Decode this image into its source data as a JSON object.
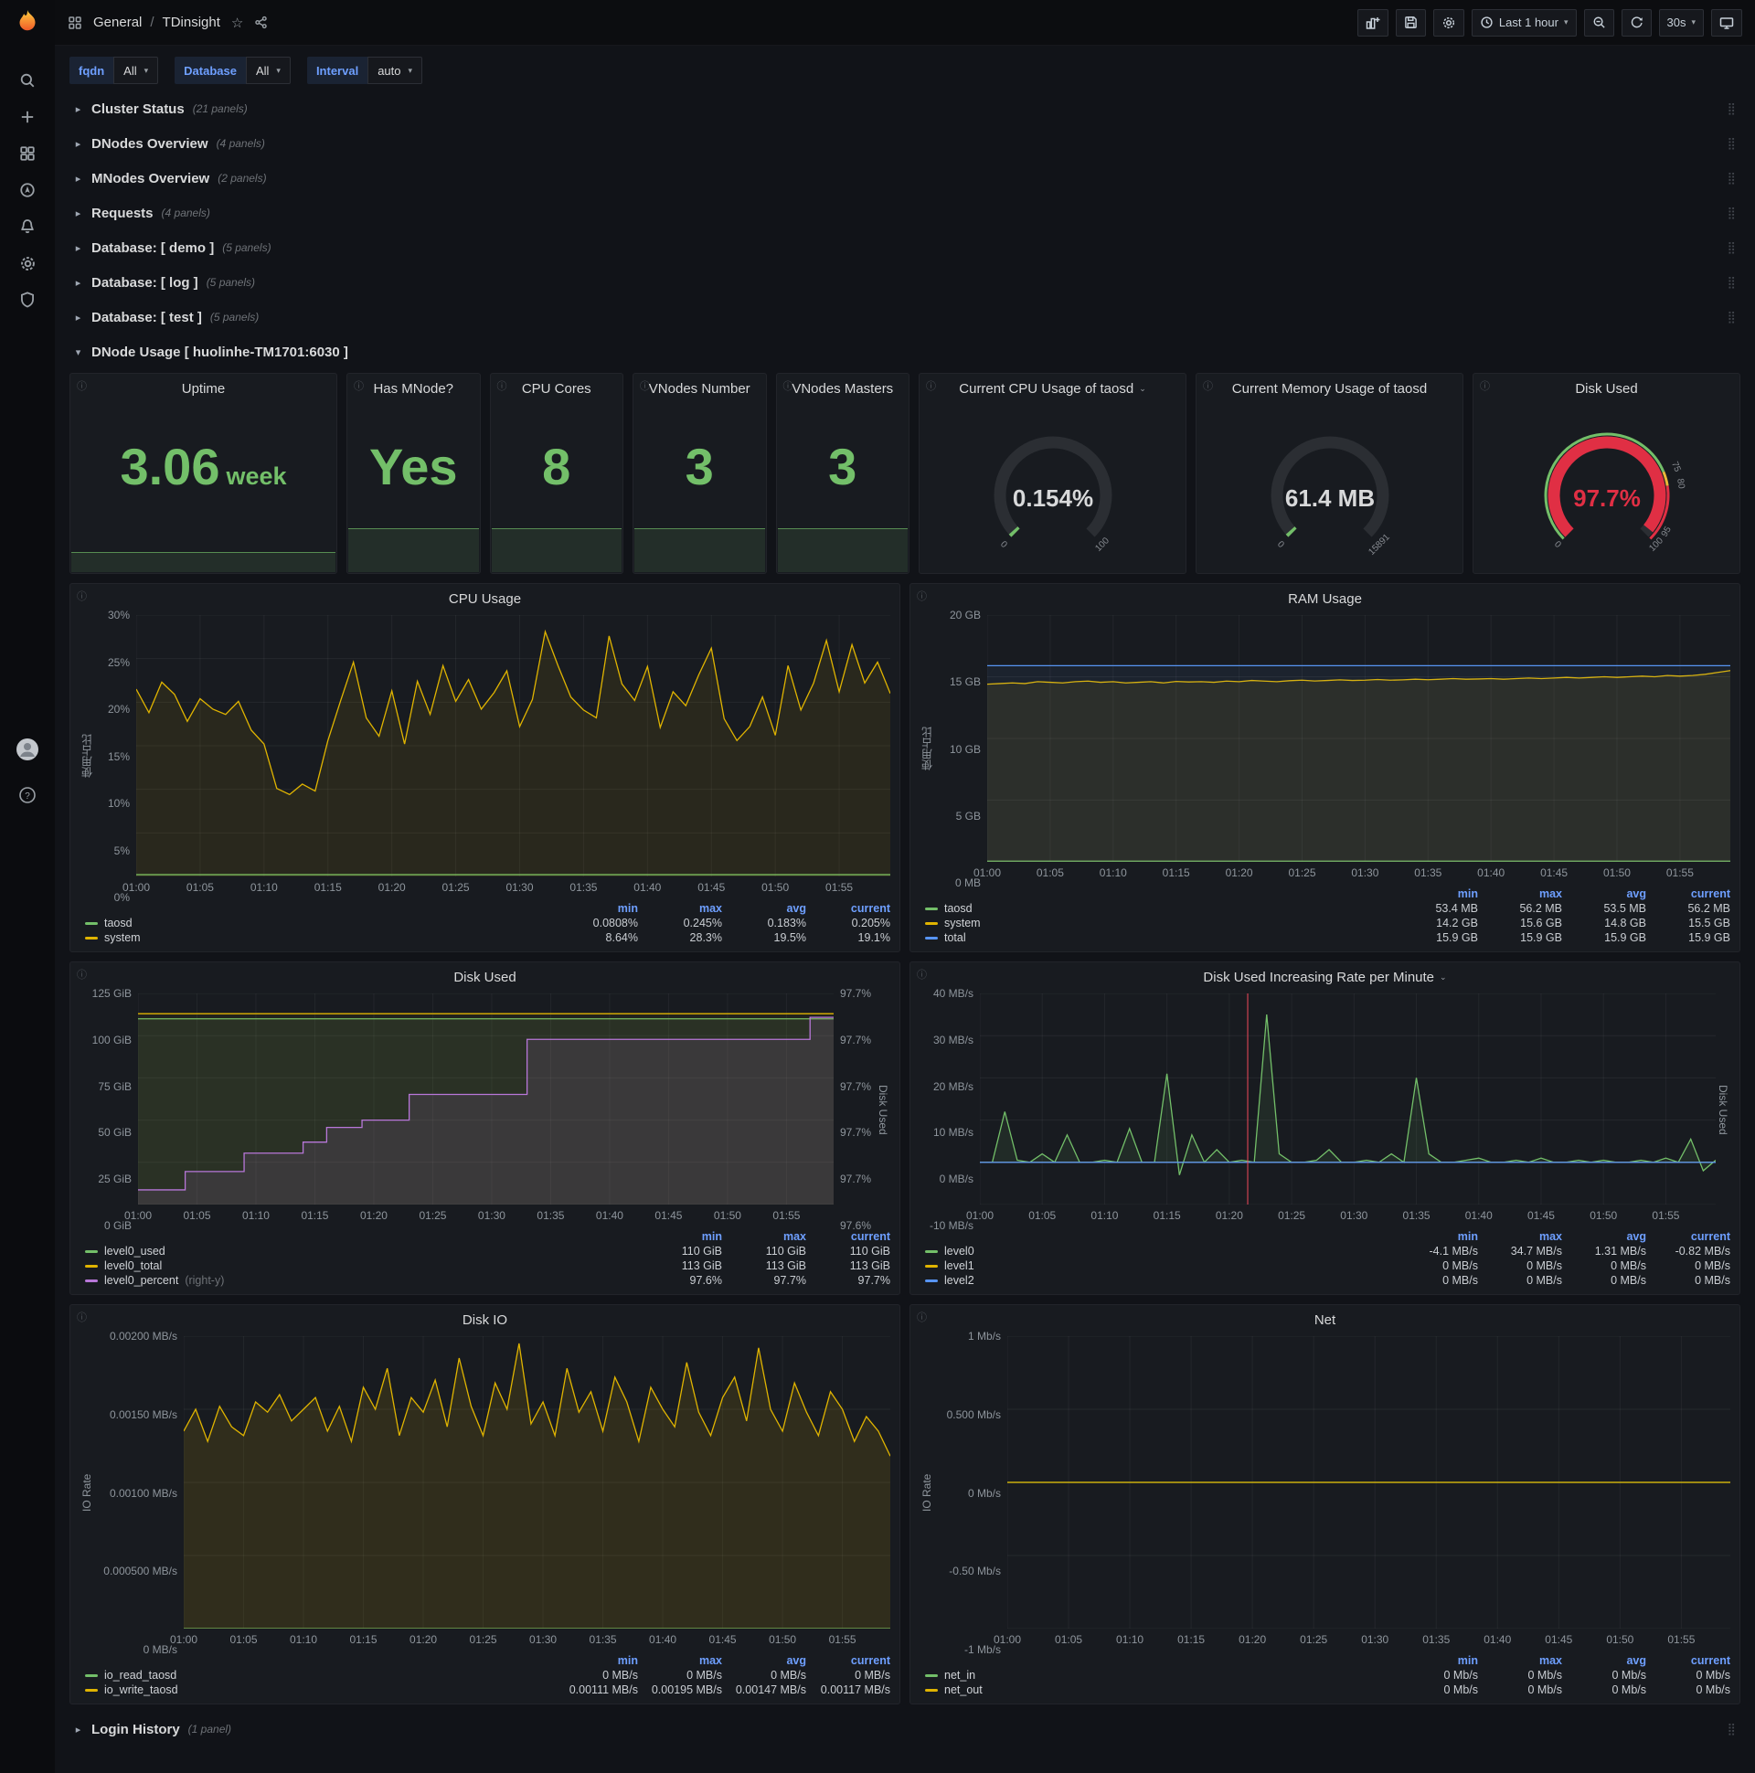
{
  "colors": {
    "green": "#73bf69",
    "yellow": "#e0b400",
    "blue": "#5794f2",
    "purple": "#b877d9",
    "red": "#f2495c",
    "gauge_red": "#e02f44",
    "threshold_orange": "#EAB839"
  },
  "topbar": {
    "section": "General",
    "sep": "/",
    "page": "TDinsight",
    "time_range": "Last 1 hour",
    "refresh": "30s"
  },
  "variables": [
    {
      "label": "fqdn",
      "value": "All"
    },
    {
      "label": "Database",
      "value": "All"
    },
    {
      "label": "Interval",
      "value": "auto"
    }
  ],
  "rows_collapsed": [
    {
      "title": "Cluster Status",
      "count": "(21 panels)"
    },
    {
      "title": "DNodes Overview",
      "count": "(4 panels)"
    },
    {
      "title": "MNodes Overview",
      "count": "(2 panels)"
    },
    {
      "title": "Requests",
      "count": "(4 panels)"
    },
    {
      "title": "Database: [ demo ]",
      "count": "(5 panels)"
    },
    {
      "title": "Database: [ log ]",
      "count": "(5 panels)"
    },
    {
      "title": "Database: [ test ]",
      "count": "(5 panels)"
    }
  ],
  "expanded_row_title": "DNode Usage [ huolinhe-TM1701:6030 ]",
  "login_row": {
    "title": "Login History",
    "count": "(1 panel)"
  },
  "stats": [
    {
      "title": "Uptime",
      "value": "3.06",
      "suffix": "week",
      "spark": 0.1
    },
    {
      "title": "Has MNode?",
      "value": "Yes",
      "suffix": "",
      "spark": 0.22
    },
    {
      "title": "CPU Cores",
      "value": "8",
      "suffix": "",
      "spark": 0.22
    },
    {
      "title": "VNodes Number",
      "value": "3",
      "suffix": "",
      "spark": 0.22
    },
    {
      "title": "VNodes Masters",
      "value": "3",
      "suffix": "",
      "spark": 0.22
    }
  ],
  "gauges": [
    {
      "id": "cpu-gauge",
      "title": "Current CPU Usage of taosd",
      "caret": true,
      "value": "0.154%",
      "frac": 0.00154,
      "color": "#73bf69",
      "value_color": "#d8d9da",
      "ticks": [
        {
          "label": "0",
          "frac": 0
        },
        {
          "label": "100",
          "frac": 1
        }
      ]
    },
    {
      "id": "mem-gauge",
      "title": "Current Memory Usage of taosd",
      "caret": false,
      "value": "61.4 MB",
      "frac": 0.0039,
      "color": "#73bf69",
      "value_color": "#d8d9da",
      "ticks": [
        {
          "label": "0",
          "frac": 0
        },
        {
          "label": "15891",
          "frac": 1
        }
      ]
    },
    {
      "id": "disk-gauge",
      "title": "Disk Used",
      "caret": false,
      "value": "97.7%",
      "frac": 0.977,
      "color": "#e02f44",
      "value_color": "#e02f44",
      "ticks": [
        {
          "label": "0",
          "frac": 0
        },
        {
          "label": "75",
          "frac": 0.75
        },
        {
          "label": "80",
          "frac": 0.8
        },
        {
          "label": "95",
          "frac": 0.95
        },
        {
          "label": "100",
          "frac": 1
        }
      ],
      "ring": [
        [
          "#73bf69",
          0,
          0.75
        ],
        [
          "#EAB839",
          0.75,
          0.8
        ],
        [
          "#e02f44",
          0.8,
          1
        ]
      ]
    }
  ],
  "x_ticks": [
    "01:00",
    "01:05",
    "01:10",
    "01:15",
    "01:20",
    "01:25",
    "01:30",
    "01:35",
    "01:40",
    "01:45",
    "01:50",
    "01:55"
  ],
  "chart_data": [
    {
      "id": "cpu_usage",
      "type": "line",
      "title": "CPU Usage",
      "caret": false,
      "y_title": "使用占比",
      "ytick_w": 46,
      "y_ticks": [
        "30%",
        "25%",
        "20%",
        "15%",
        "10%",
        "5%",
        "0%"
      ],
      "ylim": [
        0,
        30
      ],
      "series": [
        {
          "name": "taosd",
          "color": "#73bf69",
          "const": 0.2
        },
        {
          "name": "system",
          "color": "#e0b400",
          "fill": 0.09,
          "values": [
            21.5,
            18.8,
            22.3,
            20.9,
            17.8,
            20.4,
            19.2,
            18.6,
            20.1,
            16.8,
            15.2,
            10.1,
            9.4,
            10.6,
            9.8,
            15.6,
            20.2,
            24.6,
            18.2,
            16.1,
            21.3,
            15.2,
            22.4,
            18.6,
            24.2,
            20.1,
            22.6,
            19.2,
            21.1,
            23.6,
            17.2,
            20.3,
            28.1,
            24.2,
            20.6,
            19.1,
            18.2,
            27.6,
            22.1,
            20.2,
            24.1,
            17.1,
            21.2,
            19.6,
            23.1,
            26.2,
            18.1,
            15.6,
            17.2,
            20.6,
            16.2,
            24.2,
            19.1,
            22.2,
            27.1,
            21.2,
            26.6,
            22.2,
            24.6,
            21.0
          ]
        }
      ],
      "legend": {
        "cols": [
          "min",
          "max",
          "avg",
          "current"
        ],
        "rows": [
          {
            "name": "taosd",
            "color": "#73bf69",
            "values": [
              "0.0808%",
              "0.245%",
              "0.183%",
              "0.205%"
            ]
          },
          {
            "name": "system",
            "color": "#e0b400",
            "values": [
              "8.64%",
              "28.3%",
              "19.5%",
              "19.1%"
            ]
          }
        ]
      }
    },
    {
      "id": "ram_usage",
      "type": "line",
      "title": "RAM Usage",
      "caret": false,
      "y_title": "使用占比",
      "ytick_w": 58,
      "y_ticks": [
        "20 GB",
        "15 GB",
        "10 GB",
        "5 GB",
        "0 MB"
      ],
      "ylim": [
        0,
        20
      ],
      "series": [
        {
          "name": "taosd",
          "color": "#73bf69",
          "const": 0.053
        },
        {
          "name": "system",
          "color": "#e0b400",
          "fill": 0.09,
          "values": [
            14.4,
            14.45,
            14.5,
            14.45,
            14.6,
            14.55,
            14.5,
            14.6,
            14.65,
            14.55,
            14.6,
            14.5,
            14.55,
            14.6,
            14.5,
            14.62,
            14.58,
            14.6,
            14.55,
            14.65,
            14.6,
            14.7,
            14.65,
            14.6,
            14.68,
            14.72,
            14.66,
            14.7,
            14.75,
            14.7,
            14.72,
            14.78,
            14.72,
            14.75,
            14.8,
            14.76,
            14.8,
            14.85,
            14.8,
            14.82,
            14.85,
            14.8,
            14.85,
            14.9,
            14.85,
            14.9,
            14.95,
            14.9,
            14.95,
            15.0,
            14.95,
            15.0,
            15.05,
            15.0,
            15.1,
            15.05,
            15.1,
            15.2,
            15.35,
            15.5
          ]
        },
        {
          "name": "total",
          "color": "#5794f2",
          "const": 15.9,
          "fill": 0.07
        }
      ],
      "legend": {
        "cols": [
          "min",
          "max",
          "avg",
          "current"
        ],
        "rows": [
          {
            "name": "taosd",
            "color": "#73bf69",
            "values": [
              "53.4 MB",
              "56.2 MB",
              "53.5 MB",
              "56.2 MB"
            ]
          },
          {
            "name": "system",
            "color": "#e0b400",
            "values": [
              "14.2 GB",
              "15.6 GB",
              "14.8 GB",
              "15.5 GB"
            ]
          },
          {
            "name": "total",
            "color": "#5794f2",
            "values": [
              "15.9 GB",
              "15.9 GB",
              "15.9 GB",
              "15.9 GB"
            ]
          }
        ]
      }
    },
    {
      "id": "disk_used",
      "type": "line",
      "title": "Disk Used",
      "caret": false,
      "ytick_w": 64,
      "y_ticks": [
        "125 GiB",
        "100 GiB",
        "75 GiB",
        "50 GiB",
        "25 GiB",
        "0 GiB"
      ],
      "ylim": [
        0,
        125
      ],
      "right_ticks": [
        "97.7%",
        "97.7%",
        "97.7%",
        "97.7%",
        "97.7%",
        "97.6%"
      ],
      "right_ylim": [
        97.6,
        97.715
      ],
      "right_title": "Disk Used",
      "series": [
        {
          "name": "level0_used",
          "color": "#73bf69",
          "const": 110,
          "fill": 0.1
        },
        {
          "name": "level0_total",
          "color": "#e0b400",
          "const": 113,
          "fill": 0.05
        },
        {
          "name": "level0_percent",
          "color": "#b877d9",
          "fill": 0.12,
          "step": true,
          "scale": "right",
          "values": [
            97.608,
            97.608,
            97.608,
            97.608,
            97.618,
            97.618,
            97.618,
            97.618,
            97.618,
            97.628,
            97.628,
            97.628,
            97.628,
            97.628,
            97.634,
            97.634,
            97.642,
            97.642,
            97.642,
            97.646,
            97.646,
            97.646,
            97.646,
            97.66,
            97.66,
            97.66,
            97.66,
            97.66,
            97.66,
            97.66,
            97.66,
            97.66,
            97.66,
            97.69,
            97.69,
            97.69,
            97.69,
            97.69,
            97.69,
            97.69,
            97.69,
            97.69,
            97.69,
            97.69,
            97.69,
            97.69,
            97.69,
            97.69,
            97.69,
            97.69,
            97.69,
            97.69,
            97.69,
            97.69,
            97.69,
            97.69,
            97.69,
            97.702,
            97.702,
            97.702
          ]
        }
      ],
      "legend": {
        "cols": [
          "min",
          "max",
          "current"
        ],
        "rows": [
          {
            "name": "level0_used",
            "color": "#73bf69",
            "values": [
              "110 GiB",
              "110 GiB",
              "110 GiB"
            ]
          },
          {
            "name": "level0_total",
            "color": "#e0b400",
            "values": [
              "113 GiB",
              "113 GiB",
              "113 GiB"
            ]
          },
          {
            "name": "level0_percent",
            "suffix": "(right-y)",
            "color": "#b877d9",
            "values": [
              "97.6%",
              "97.7%",
              "97.7%"
            ]
          }
        ]
      }
    },
    {
      "id": "disk_rate",
      "type": "line",
      "title": "Disk Used Increasing Rate per Minute",
      "caret": true,
      "ytick_w": 66,
      "y_ticks": [
        "40 MB/s",
        "30 MB/s",
        "20 MB/s",
        "10 MB/s",
        "0 MB/s",
        "-10 MB/s"
      ],
      "ylim": [
        -10,
        40
      ],
      "right_title": "Disk Used",
      "annotation_frac": 0.364,
      "series": [
        {
          "name": "level0",
          "color": "#73bf69",
          "fill": 0.1,
          "values": [
            0,
            0,
            12,
            0.5,
            0,
            2,
            0,
            6.5,
            0,
            0,
            0.5,
            0,
            8,
            0,
            0,
            21,
            -3,
            6.5,
            0,
            3,
            0,
            0.5,
            0,
            35,
            2,
            0,
            0,
            0.5,
            3,
            0,
            0,
            0.5,
            0,
            2,
            0,
            20,
            2,
            0,
            0,
            0.5,
            1,
            0,
            0,
            0.5,
            0,
            1,
            0,
            0,
            0.5,
            0,
            0.5,
            0,
            0,
            0.5,
            0,
            1,
            0,
            5.5,
            -2,
            0.5
          ]
        },
        {
          "name": "level1",
          "color": "#e0b400",
          "const": 0
        },
        {
          "name": "level2",
          "color": "#5794f2",
          "const": 0
        }
      ],
      "legend": {
        "cols": [
          "min",
          "max",
          "avg",
          "current"
        ],
        "rows": [
          {
            "name": "level0",
            "color": "#73bf69",
            "values": [
              "-4.1 MB/s",
              "34.7 MB/s",
              "1.31 MB/s",
              "-0.82 MB/s"
            ]
          },
          {
            "name": "level1",
            "color": "#e0b400",
            "values": [
              "0 MB/s",
              "0 MB/s",
              "0 MB/s",
              "0 MB/s"
            ]
          },
          {
            "name": "level2",
            "color": "#5794f2",
            "values": [
              "0 MB/s",
              "0 MB/s",
              "0 MB/s",
              "0 MB/s"
            ]
          }
        ]
      }
    },
    {
      "id": "disk_io",
      "type": "line",
      "title": "Disk IO",
      "caret": false,
      "y_title": "IO Rate",
      "ytick_w": 98,
      "y_ticks": [
        "0.00200 MB/s",
        "0.00150 MB/s",
        "0.00100 MB/s",
        "0.000500 MB/s",
        "0 MB/s"
      ],
      "ylim": [
        0,
        0.002
      ],
      "series": [
        {
          "name": "io_read_taosd",
          "color": "#73bf69",
          "const": 0
        },
        {
          "name": "io_write_taosd",
          "color": "#e0b400",
          "fill": 0.12,
          "values": [
            0.00135,
            0.0015,
            0.00128,
            0.00152,
            0.00138,
            0.00132,
            0.00155,
            0.00148,
            0.0016,
            0.00142,
            0.0015,
            0.00158,
            0.00135,
            0.00152,
            0.00128,
            0.00165,
            0.0015,
            0.00178,
            0.00132,
            0.00158,
            0.00148,
            0.0017,
            0.00138,
            0.00185,
            0.00152,
            0.00132,
            0.00168,
            0.0015,
            0.00195,
            0.0014,
            0.00155,
            0.00132,
            0.00178,
            0.00148,
            0.00162,
            0.00135,
            0.00172,
            0.00155,
            0.00128,
            0.00165,
            0.0015,
            0.00138,
            0.00182,
            0.00148,
            0.00132,
            0.00158,
            0.00172,
            0.00142,
            0.00192,
            0.0015,
            0.00135,
            0.00168,
            0.00148,
            0.00132,
            0.00162,
            0.0015,
            0.00128,
            0.00145,
            0.00135,
            0.00118
          ]
        }
      ],
      "legend": {
        "cols": [
          "min",
          "max",
          "avg",
          "current"
        ],
        "rows": [
          {
            "name": "io_read_taosd",
            "color": "#73bf69",
            "values": [
              "0 MB/s",
              "0 MB/s",
              "0 MB/s",
              "0 MB/s"
            ]
          },
          {
            "name": "io_write_taosd",
            "color": "#e0b400",
            "values": [
              "0.00111 MB/s",
              "0.00195 MB/s",
              "0.00147 MB/s",
              "0.00117 MB/s"
            ]
          }
        ]
      }
    },
    {
      "id": "net",
      "type": "line",
      "title": "Net",
      "caret": false,
      "y_title": "IO Rate",
      "ytick_w": 80,
      "y_ticks": [
        "1 Mb/s",
        "0.500 Mb/s",
        "0 Mb/s",
        "-0.50 Mb/s",
        "-1 Mb/s"
      ],
      "ylim": [
        -1,
        1
      ],
      "series": [
        {
          "name": "net_in",
          "color": "#73bf69",
          "const": 0
        },
        {
          "name": "net_out",
          "color": "#e0b400",
          "const": 0
        }
      ],
      "legend": {
        "cols": [
          "min",
          "max",
          "avg",
          "current"
        ],
        "rows": [
          {
            "name": "net_in",
            "color": "#73bf69",
            "values": [
              "0 Mb/s",
              "0 Mb/s",
              "0 Mb/s",
              "0 Mb/s"
            ]
          },
          {
            "name": "net_out",
            "color": "#e0b400",
            "values": [
              "0 Mb/s",
              "0 Mb/s",
              "0 Mb/s",
              "0 Mb/s"
            ]
          }
        ]
      }
    }
  ]
}
